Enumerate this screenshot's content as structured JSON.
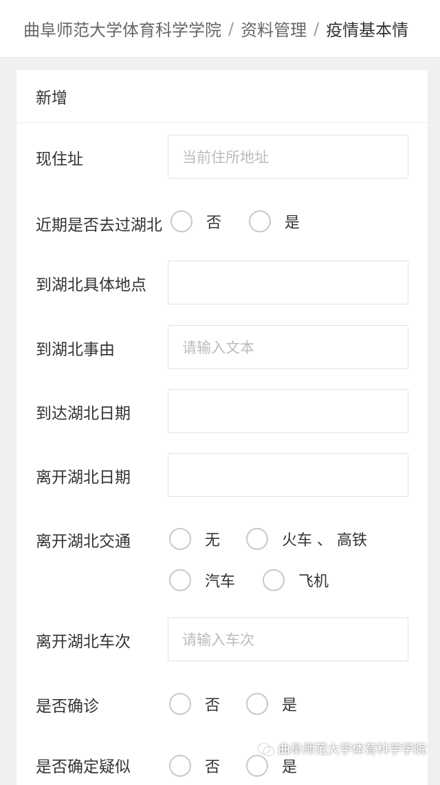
{
  "breadcrumb": {
    "items": [
      "曲阜师范大学体育科学学院",
      "资料管理",
      "疫情基本情"
    ],
    "separator": "/"
  },
  "card": {
    "title": "新增"
  },
  "form": {
    "address_label": "现住址",
    "address_placeholder": "当前住所地址",
    "been_hubei_label": "近期是否去过湖北",
    "been_hubei_options": [
      "否",
      "是"
    ],
    "hubei_place_label": "到湖北具体地点",
    "hubei_reason_label": "到湖北事由",
    "hubei_reason_placeholder": "请输入文本",
    "arrive_date_label": "到达湖北日期",
    "leave_date_label": "离开湖北日期",
    "transport_label": "离开湖北交通",
    "transport_options": [
      "无",
      "火车 、 高铁",
      "汽车",
      "飞机"
    ],
    "train_no_label": "离开湖北车次",
    "train_no_placeholder": "请输入车次",
    "confirmed_label": "是否确诊",
    "confirmed_options": [
      "否",
      "是"
    ],
    "suspected_label": "是否确定疑似",
    "suspected_options": [
      "否",
      "是"
    ]
  },
  "watermark": {
    "text": "曲阜师范大学体育科学学院",
    "icon": "wechat-icon"
  }
}
